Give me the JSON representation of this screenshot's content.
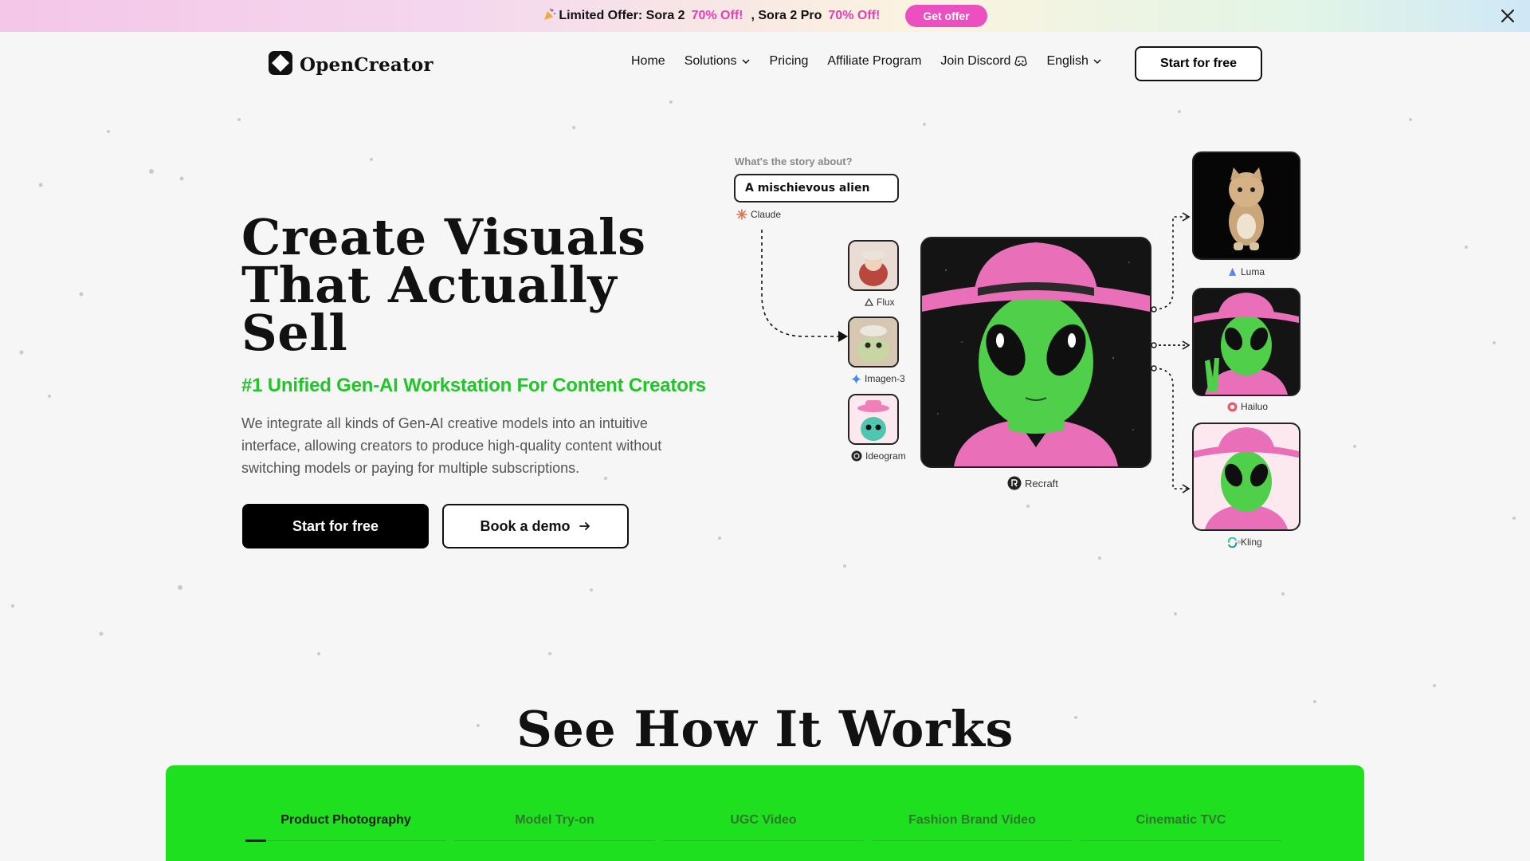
{
  "promo": {
    "party_icon": "party-popper-icon",
    "label": "Limited Offer: Sora 2",
    "discount1": "70% Off!",
    "label2": ", Sora 2 Pro",
    "discount2": "70% Off!",
    "button": "Get offer",
    "accent": "#ec4fc0"
  },
  "nav": {
    "brand": "OpenCreator",
    "links": [
      "Home",
      "Solutions",
      "Pricing",
      "Affiliate Program",
      "Join Discord",
      "English"
    ],
    "cta": "Start for free"
  },
  "hero": {
    "title_lines": [
      "Create Visuals",
      "That Actually",
      "Sell"
    ],
    "subtitle": "#1 Unified Gen-AI Workstation For Content Creators",
    "description": "We integrate all kinds of Gen-AI creative models into an intuitive interface, allowing creators to produce high-quality content without switching models or paying for multiple subscriptions.",
    "primary_cta": "Start for free",
    "secondary_cta": "Book a demo",
    "accent": "#22c42a"
  },
  "workflow": {
    "prompt_label": "What's the story about?",
    "prompt_value": "A mischievous alien",
    "models": {
      "claude": "Claude",
      "flux": "Flux",
      "imagen": "Imagen-3",
      "ideogram": "Ideogram",
      "recraft": "Recraft",
      "luma": "Luma",
      "hailuo": "Hailuo",
      "kling": "Kling"
    }
  },
  "how_it_works": {
    "title": "See How It Works",
    "tabs": [
      "Product Photography",
      "Model Try-on",
      "UGC Video",
      "Fashion Brand Video",
      "Cinematic TVC"
    ],
    "active_tab": 0,
    "panel_color": "#1fe01f"
  }
}
